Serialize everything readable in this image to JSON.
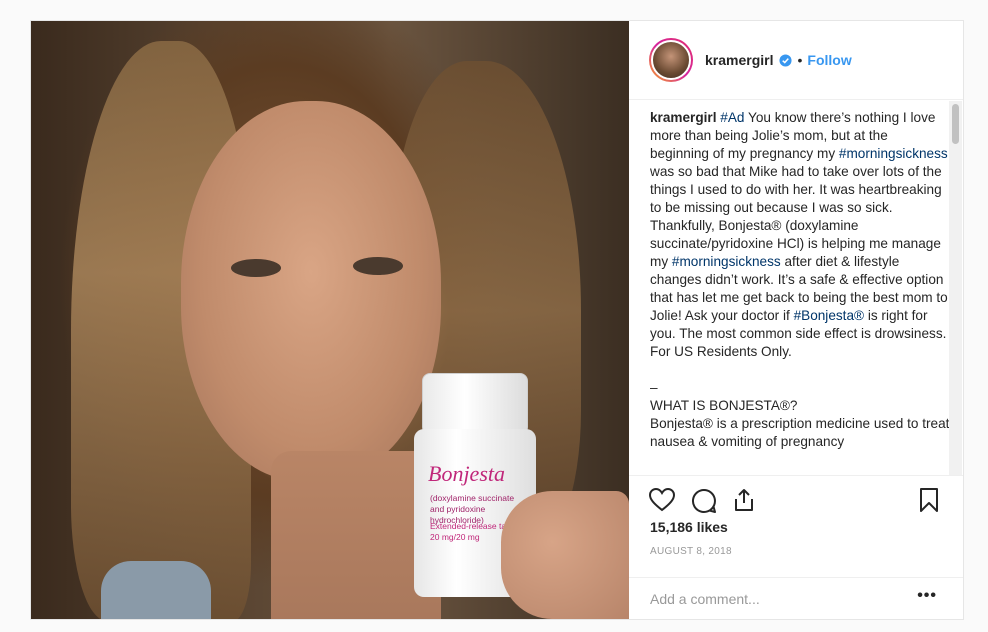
{
  "header": {
    "username": "kramergirl",
    "separator": "•",
    "follow_label": "Follow"
  },
  "caption": {
    "username": "kramergirl",
    "parts": [
      {
        "text": "#Ad",
        "tag": true
      },
      {
        "text": " You know there’s nothing I love more than being Jolie’s mom, but at the beginning of my pregnancy my ",
        "tag": false
      },
      {
        "text": "#morningsickness",
        "tag": true
      },
      {
        "text": " was so bad that Mike had to take over lots of the things I used to do with her. It was heartbreaking to be missing out because I was so sick. Thankfully, Bonjesta® (doxylamine succinate/pyridoxine HCl) is helping me manage my ",
        "tag": false
      },
      {
        "text": "#morningsickness",
        "tag": true
      },
      {
        "text": " after diet & lifestyle changes didn’t work. It’s a safe & effective option that has let me get back to being the best mom to Jolie! Ask your doctor if ",
        "tag": false
      },
      {
        "text": "#Bonjesta®",
        "tag": true
      },
      {
        "text": " is right for you. The most common side effect is drowsiness. For US Residents Only.",
        "tag": false
      }
    ],
    "dash": "–",
    "heading": "WHAT IS BONJESTA®?",
    "body": "Bonjesta® is a prescription medicine used to treat nausea & vomiting of pregnancy"
  },
  "product": {
    "brand": "Bonjesta",
    "line1": "(doxylamine succinate and pyridoxine hydrochloride)",
    "line2": "Extended-release tablets",
    "line3": "20 mg/20 mg"
  },
  "actions": {
    "likes": "15,186 likes",
    "date": "AUGUST 8, 2018"
  },
  "comment": {
    "placeholder": "Add a comment...",
    "more": "•••"
  },
  "colors": {
    "link": "#3897f0",
    "hashtag": "#003569",
    "brand_pink": "#c0277a"
  }
}
